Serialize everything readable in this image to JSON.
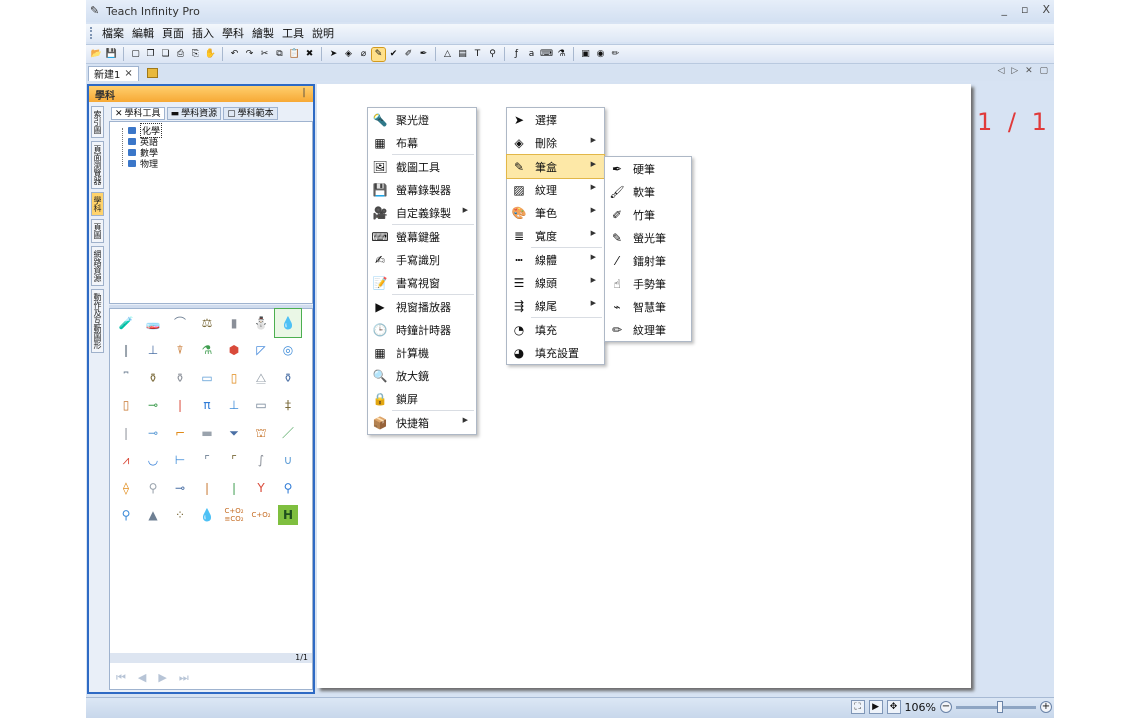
{
  "window": {
    "title": "Teach Infinity Pro",
    "controls": [
      "_",
      "▫",
      "X"
    ]
  },
  "menubar": {
    "items": [
      "檔案",
      "編輯",
      "頁面",
      "插入",
      "學科",
      "繪製",
      "工具",
      "說明"
    ]
  },
  "toolbar": {
    "icons": [
      "open-icon",
      "save-icon",
      "sep",
      "new-page-icon",
      "copy-page-icon",
      "paste-page-icon",
      "print-icon",
      "print-preview-icon",
      "hand-icon",
      "sep",
      "undo-icon",
      "redo-icon",
      "cut-icon",
      "copy-icon",
      "paste-icon",
      "delete-icon",
      "sep",
      "select-icon",
      "eraser-icon",
      "shape-icon",
      "pen-icon",
      "check-pen-icon",
      "color-pen-icon",
      "highlighter-icon",
      "sep",
      "triangle-icon",
      "film-icon",
      "text-icon",
      "stamp-icon",
      "sep",
      "math-icon",
      "abc-icon",
      "keyboard-icon",
      "flask-icon",
      "sep",
      "camera-icon",
      "record-icon",
      "brush-icon"
    ]
  },
  "doc_tabs": {
    "tabs": [
      {
        "label": "新建1",
        "close": "×"
      }
    ],
    "nav": "◁ ▷ ✕ ▢"
  },
  "left_panel": {
    "title": "學科",
    "pin": "ᛁ",
    "vertical_tabs": [
      "索引圖",
      "頁面瀏覽器",
      "學科",
      "頁圖",
      "網路資源",
      "動作及互動圖形"
    ],
    "active_vertical_tab": 2,
    "tabs": [
      "學科工具",
      "學科資源",
      "學科範本"
    ],
    "tree": [
      "化學",
      "英語",
      "數學",
      "物理"
    ],
    "gallery_icons": [
      [
        "beaker",
        "test-tube",
        "tap",
        "balance",
        "gas-bottle",
        "spirit-lamp",
        "flame"
      ],
      [
        "thermometer",
        "stand",
        "funnel",
        "burette-stand",
        "hexagon",
        "flask-shape",
        "bullseye"
      ],
      [
        "tube-rack",
        "round-flask",
        "side-arm-flask",
        "trough",
        "reagent-bottle",
        "conical-flask",
        "volumetric-flask"
      ],
      [
        "wide-bottle",
        "pipe",
        "dropper",
        "tripod",
        "clamp-stand",
        "battery",
        "distiller"
      ],
      [
        "dropper-pipette",
        "spatula",
        "bent-tube",
        "crucible",
        "wood-block",
        "bunsen-burner",
        "glass-rod"
      ],
      [
        "asbestos-gauze",
        "evaporating-dish",
        "connector",
        "elbow-tube",
        "corner-tube",
        "s-tube",
        "u-tube"
      ],
      [
        "separatory-funnel",
        "match",
        "three-way",
        "rod",
        "straight-tube",
        "y-funnel",
        "filter-funnel"
      ],
      [
        "funnel-stand",
        "mound",
        "particles",
        "drop",
        "formula-c-o2",
        "formula-c-o",
        "hydrogen-tile"
      ]
    ],
    "gallery_symbols": [
      [
        "🧪",
        "🧫",
        "⌒",
        "⚖",
        "▮",
        "⛄",
        "💧"
      ],
      [
        "❙",
        "⊥",
        "⍒",
        "⚗",
        "⬢",
        "◸",
        "◎"
      ],
      [
        "⎴",
        "⚱",
        "⚱",
        "▭",
        "▯",
        "⧋",
        "⚱"
      ],
      [
        "▯",
        "⊸",
        "❘",
        "π",
        "⊥",
        "▭",
        "‡"
      ],
      [
        "❘",
        "⊸",
        "⌐",
        "▬",
        "⏷",
        "⛫",
        "／"
      ],
      [
        "⩘",
        "◡",
        "⊢",
        "⌜",
        "⌜",
        "∫",
        "∪"
      ],
      [
        "⟠",
        "⚲",
        "⊸",
        "❘",
        "❘",
        "Y",
        "⚲"
      ],
      [
        "⚲",
        "▲",
        "⁘",
        "💧",
        "C+O₂\n≡CO₂",
        "C+O₂",
        "H"
      ]
    ],
    "selected_icon": [
      0,
      6
    ],
    "page_indicator": "1/1",
    "pager_nav": [
      "⏮",
      "◀",
      "▶",
      "⏭"
    ]
  },
  "page_counter": "1 / 1",
  "tools_menu": {
    "items": [
      {
        "label": "聚光燈",
        "icon": "spotlight-icon",
        "glyph": "🔦"
      },
      {
        "label": "布幕",
        "icon": "curtain-icon",
        "glyph": "▦"
      },
      {
        "sep": true
      },
      {
        "label": "截圖工具",
        "icon": "screenshot-icon",
        "glyph": "🖼"
      },
      {
        "label": "螢幕錄製器",
        "icon": "screen-recorder-icon",
        "glyph": "💾"
      },
      {
        "label": "自定義錄製",
        "icon": "custom-record-icon",
        "glyph": "🎥",
        "submenu": true
      },
      {
        "sep": true
      },
      {
        "label": "螢幕鍵盤",
        "icon": "keyboard-icon",
        "glyph": "⌨"
      },
      {
        "label": "手寫識別",
        "icon": "handwriting-icon",
        "glyph": "✍"
      },
      {
        "label": "書寫視窗",
        "icon": "writing-window-icon",
        "glyph": "📝"
      },
      {
        "sep": true
      },
      {
        "label": "視窗播放器",
        "icon": "video-player-icon",
        "glyph": "▶"
      },
      {
        "label": "時鐘計時器",
        "icon": "clock-icon",
        "glyph": "🕒"
      },
      {
        "label": "計算機",
        "icon": "calculator-icon",
        "glyph": "▦"
      },
      {
        "label": "放大鏡",
        "icon": "magnifier-icon",
        "glyph": "🔍"
      },
      {
        "label": "鎖屏",
        "icon": "lock-screen-icon",
        "glyph": "🔒"
      },
      {
        "sep": true
      },
      {
        "label": "快捷箱",
        "icon": "shortcut-box-icon",
        "glyph": "📦",
        "submenu": true
      }
    ]
  },
  "draw_menu": {
    "items": [
      {
        "label": "選擇",
        "icon": "select-arrow-icon",
        "glyph": "➤"
      },
      {
        "label": "刪除",
        "icon": "eraser-icon",
        "glyph": "◈",
        "submenu": true
      },
      {
        "sep": true
      },
      {
        "label": "筆盒",
        "icon": "pen-box-icon",
        "glyph": "✎",
        "submenu": true,
        "hover": true
      },
      {
        "label": "紋理",
        "icon": "texture-icon",
        "glyph": "▨",
        "submenu": true
      },
      {
        "label": "筆色",
        "icon": "pen-color-icon",
        "glyph": "🎨",
        "submenu": true
      },
      {
        "label": "寬度",
        "icon": "width-icon",
        "glyph": "≣",
        "submenu": true
      },
      {
        "sep": true
      },
      {
        "label": "線體",
        "icon": "line-style-icon",
        "glyph": "┅",
        "submenu": true
      },
      {
        "label": "線頭",
        "icon": "line-head-icon",
        "glyph": "☰",
        "submenu": true
      },
      {
        "label": "線尾",
        "icon": "line-tail-icon",
        "glyph": "⇶",
        "submenu": true
      },
      {
        "sep": true
      },
      {
        "label": "填充",
        "icon": "fill-icon",
        "glyph": "◔"
      },
      {
        "label": "填充設置",
        "icon": "fill-settings-icon",
        "glyph": "◕"
      }
    ]
  },
  "pen_menu": {
    "items": [
      {
        "label": "硬筆",
        "icon": "hard-pen-icon",
        "glyph": "✒"
      },
      {
        "label": "軟筆",
        "icon": "soft-pen-icon",
        "glyph": "🖌"
      },
      {
        "label": "竹筆",
        "icon": "bamboo-pen-icon",
        "glyph": "✐"
      },
      {
        "label": "螢光筆",
        "icon": "highlighter-pen-icon",
        "glyph": "✎"
      },
      {
        "label": "鐳射筆",
        "icon": "laser-pen-icon",
        "glyph": "⁄"
      },
      {
        "label": "手勢筆",
        "icon": "gesture-pen-icon",
        "glyph": "☝"
      },
      {
        "label": "智慧筆",
        "icon": "smart-pen-icon",
        "glyph": "⌁"
      },
      {
        "label": "紋理筆",
        "icon": "texture-pen-icon",
        "glyph": "✏"
      }
    ]
  },
  "statusbar": {
    "zoom": "106%",
    "zoom_minus": "−",
    "zoom_plus": "+",
    "zoom_level": 0.55
  },
  "colors": {
    "accent": "#2e6ac4",
    "page_counter": "#e03a3a",
    "hover": "#fde8a7"
  }
}
